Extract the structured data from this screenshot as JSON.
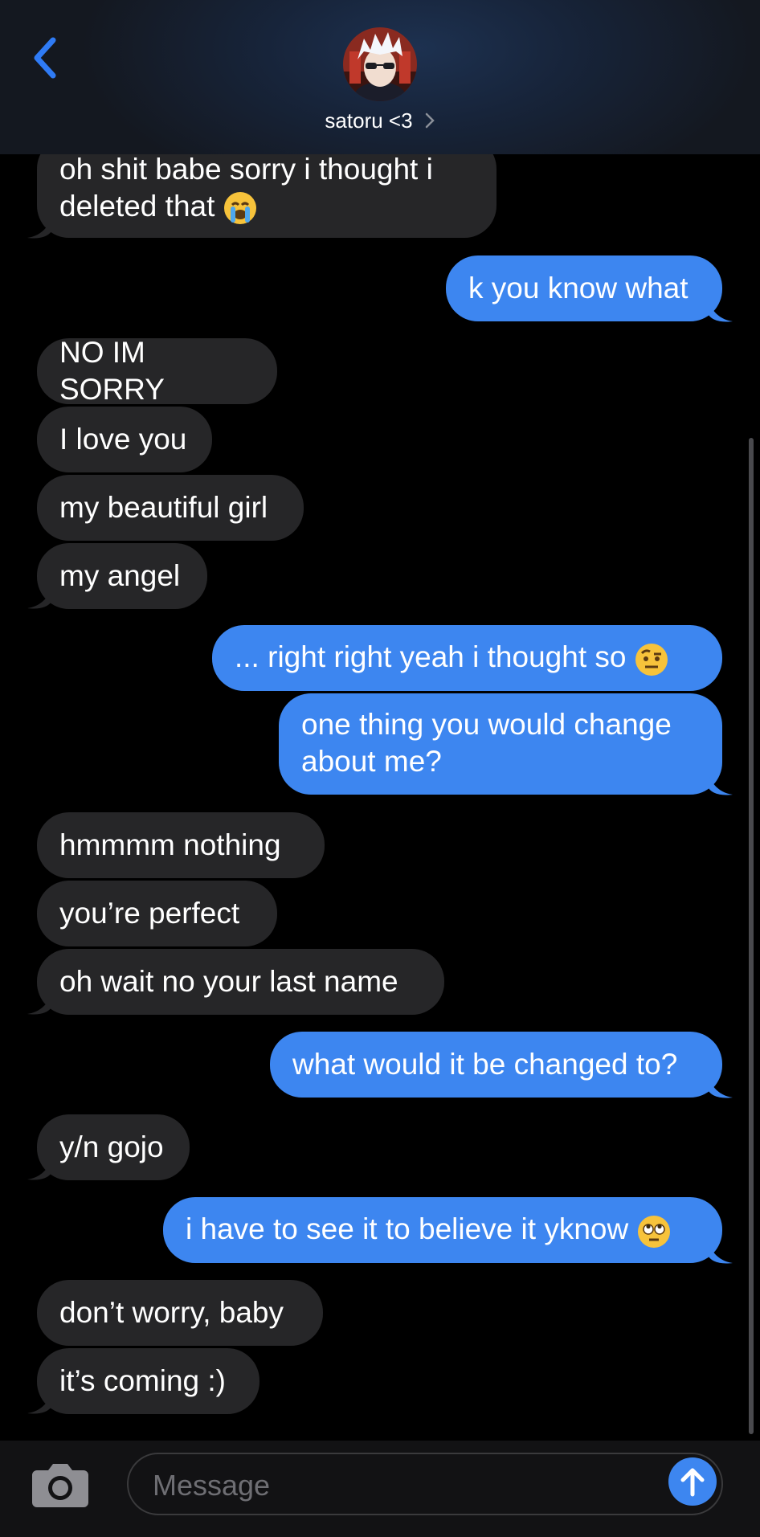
{
  "header": {
    "contact_name": "satoru <3",
    "chevron": "›",
    "back_icon": "chevron-left-icon"
  },
  "messages": [
    {
      "from": "them",
      "text": "oh shit babe sorry i thought i\ndeleted that",
      "emoji": "loudly-crying-face"
    },
    {
      "from": "me",
      "text": "k you know what"
    },
    {
      "from": "them",
      "text": "NO IM SORRY"
    },
    {
      "from": "them",
      "text": "I love you"
    },
    {
      "from": "them",
      "text": "my beautiful girl"
    },
    {
      "from": "them",
      "text": "my angel"
    },
    {
      "from": "me",
      "text": "... right right yeah i thought so",
      "emoji": "face-with-raised-eyebrow"
    },
    {
      "from": "me",
      "text": "one thing you would change\nabout me?"
    },
    {
      "from": "them",
      "text": "hmmmm nothing"
    },
    {
      "from": "them",
      "text": "you’re perfect"
    },
    {
      "from": "them",
      "text": "oh wait no your last name"
    },
    {
      "from": "me",
      "text": "what would it be changed to?"
    },
    {
      "from": "them",
      "text": "y/n gojo"
    },
    {
      "from": "me",
      "text": "i have to see it to believe it yknow",
      "emoji": "face-with-rolling-eyes"
    },
    {
      "from": "them",
      "text": "don’t worry, baby"
    },
    {
      "from": "them",
      "text": "it’s coming :)"
    }
  ],
  "composer": {
    "placeholder": "Message",
    "camera_icon": "camera-icon",
    "send_icon": "arrow-up-icon"
  },
  "colors": {
    "sent_bubble": "#3d86f0",
    "received_bubble": "#262628",
    "accent": "#2f7bf5"
  }
}
